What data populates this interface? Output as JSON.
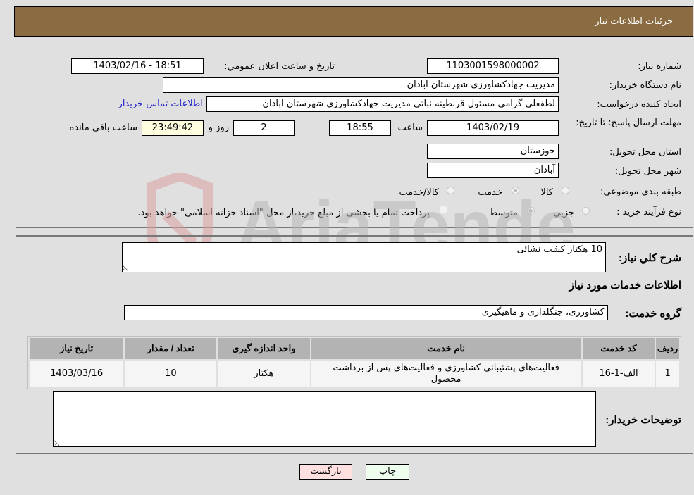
{
  "header": {
    "title": "جزئیات اطلاعات نیاز"
  },
  "fields": {
    "need_number": {
      "label": "شماره نیاز:",
      "value": "1103001598000002"
    },
    "announce_datetime": {
      "label": "تاریخ و ساعت اعلان عمومي:",
      "value": "1403/02/16 - 18:51"
    },
    "buyer_org": {
      "label": "نام دستگاه خریدار:",
      "value": "مدیریت جهادکشاورزی شهرستان ابادان"
    },
    "creator": {
      "label": "ایجاد کننده درخواست:",
      "value": "لطفعلی گرامی مسئول قرنطینه نباتی مدیریت جهادکشاورزی شهرستان ابادان"
    },
    "buyer_contact_link": "اطلاعات تماس خریدار",
    "deadline": {
      "label": "مهلت ارسال پاسخ: تا تاریخ:",
      "date": "1403/02/19",
      "time_label": "ساعت",
      "time": "18:55",
      "days": "2",
      "days_label": "روز و",
      "remaining": "23:49:42",
      "remaining_label": "ساعت باقي مانده"
    },
    "province": {
      "label": "استان محل تحویل:",
      "value": "خوزستان"
    },
    "city": {
      "label": "شهر محل تحویل:",
      "value": "آبادان"
    },
    "category": {
      "label": "طبقه بندی موضوعی:",
      "options": [
        "کالا",
        "خدمت",
        "کالا/خدمت"
      ],
      "selected": "خدمت"
    },
    "purchase_type": {
      "label": "نوع فرآیند خرید :",
      "options": [
        "جزيي",
        "متوسط"
      ],
      "selected": "متوسط",
      "treasury_note": "پرداخت تمام یا بخشی از مبلغ خرید،از محل \"اسناد خزانه اسلامی\" خواهد بود."
    }
  },
  "description": {
    "label": "شرح کلي نیاز:",
    "value": "10 هکتار کشت نشائی"
  },
  "services_section": {
    "title": "اطلاعات خدمات مورد نیاز",
    "group_label": "گروه خدمت:",
    "group_value": "کشاورزی، جنگلداری و ماهیگیری"
  },
  "table": {
    "headers": [
      "ردیف",
      "کد خدمت",
      "نام خدمت",
      "واحد اندازه گیری",
      "تعداد / مقدار",
      "تاریخ نیاز"
    ],
    "rows": [
      [
        "1",
        "الف-1-16",
        "فعالیت‌های پشتیبانی کشاورزی و فعالیت‌های پس از برداشت محصول",
        "هکتار",
        "10",
        "1403/03/16"
      ]
    ]
  },
  "buyer_notes": {
    "label": "توضیحات خریدار:",
    "value": ""
  },
  "buttons": {
    "print": "چاپ",
    "back": "بازگشت"
  },
  "watermark": {
    "text": "AriaTender.neT"
  },
  "colors": {
    "header_bg": "#8b6c42",
    "print_bg": "#efffef",
    "back_bg": "#ffe0e0",
    "link": "#2222cc"
  }
}
